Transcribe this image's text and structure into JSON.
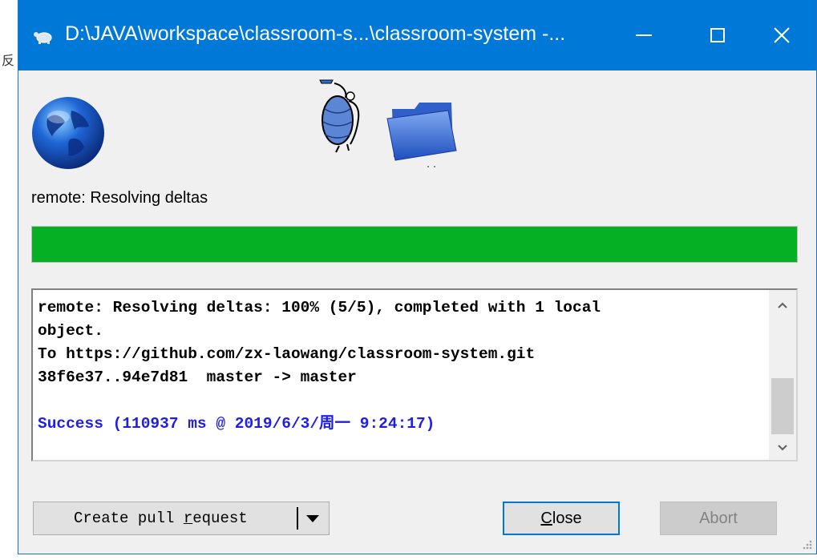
{
  "background": {
    "edge_glyph": "反"
  },
  "window": {
    "title": "D:\\JAVA\\workspace\\classroom-s...\\classroom-system -...",
    "controls": {
      "close_glyph": "✕"
    }
  },
  "icons": {
    "title": "tortoise-icon",
    "remote": "globe-icon",
    "mascot": "tortoise-mascot-icon",
    "local": "folder-icon"
  },
  "status": {
    "text": "remote: Resolving deltas"
  },
  "progress": {
    "percent": 100,
    "color": "#06b025"
  },
  "log": {
    "lines": [
      "remote: Resolving deltas: 100% (5/5), completed with 1 local",
      "object.",
      "To https://github.com/zx-laowang/classroom-system.git",
      "38f6e37..94e7d81  master -> master",
      "",
      "Success (110937 ms @ 2019/6/3/周一 9:24:17)"
    ],
    "success_color": "#1e1ee6"
  },
  "buttons": {
    "create_pr_label": "Create pull request",
    "close_label": "Close",
    "abort_label": "Abort"
  },
  "colors": {
    "titlebar": "#0078d7",
    "accent": "#0078d7"
  }
}
